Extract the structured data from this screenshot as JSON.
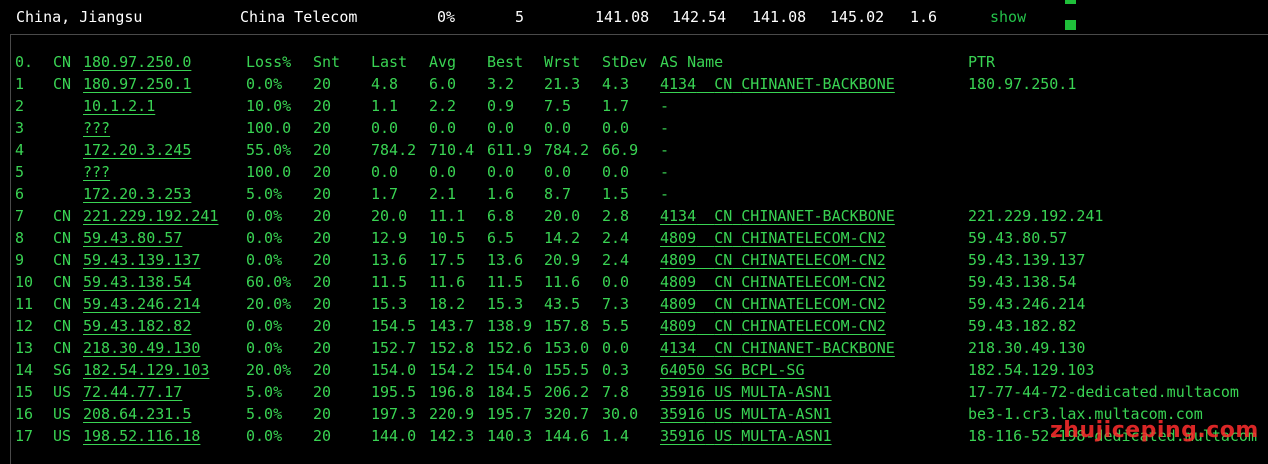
{
  "summary": {
    "location": "China, Jiangsu",
    "isp": "China Telecom",
    "loss": "0%",
    "sent": "5",
    "last": "141.08",
    "avg": "142.54",
    "best": "141.08",
    "worst": "145.02",
    "stdev": "1.6",
    "show_link": "show"
  },
  "headers": {
    "num": "0.",
    "cc": "CN",
    "host": "180.97.250.0",
    "loss": "Loss%",
    "snt": "Snt",
    "last": "Last",
    "avg": "Avg",
    "best": "Best",
    "wrst": "Wrst",
    "stdev": "StDev",
    "asname": "AS Name",
    "ptr": "PTR"
  },
  "rows": [
    {
      "num": "1",
      "cc": "CN",
      "host": "180.97.250.1",
      "loss": "0.0%",
      "snt": "20",
      "last": "4.8",
      "avg": "6.0",
      "best": "3.2",
      "wrst": "21.3",
      "stdev": "4.3",
      "asn": "4134",
      "ascc": "CN",
      "asname": "CHINANET-BACKBONE",
      "ptr": "180.97.250.1"
    },
    {
      "num": "2",
      "cc": "",
      "host": "10.1.2.1",
      "loss": "10.0%",
      "snt": "20",
      "last": "1.1",
      "avg": "2.2",
      "best": "0.9",
      "wrst": "7.5",
      "stdev": "1.7",
      "asn": "-",
      "ascc": "",
      "asname": "",
      "ptr": ""
    },
    {
      "num": "3",
      "cc": "",
      "host": "???",
      "loss": "100.0",
      "snt": "20",
      "last": "0.0",
      "avg": "0.0",
      "best": "0.0",
      "wrst": "0.0",
      "stdev": "0.0",
      "asn": "-",
      "ascc": "",
      "asname": "",
      "ptr": ""
    },
    {
      "num": "4",
      "cc": "",
      "host": "172.20.3.245",
      "loss": "55.0%",
      "snt": "20",
      "last": "784.2",
      "avg": "710.4",
      "best": "611.9",
      "wrst": "784.2",
      "stdev": "66.9",
      "asn": "-",
      "ascc": "",
      "asname": "",
      "ptr": ""
    },
    {
      "num": "5",
      "cc": "",
      "host": "???",
      "loss": "100.0",
      "snt": "20",
      "last": "0.0",
      "avg": "0.0",
      "best": "0.0",
      "wrst": "0.0",
      "stdev": "0.0",
      "asn": "-",
      "ascc": "",
      "asname": "",
      "ptr": ""
    },
    {
      "num": "6",
      "cc": "",
      "host": "172.20.3.253",
      "loss": "5.0%",
      "snt": "20",
      "last": "1.7",
      "avg": "2.1",
      "best": "1.6",
      "wrst": "8.7",
      "stdev": "1.5",
      "asn": "-",
      "ascc": "",
      "asname": "",
      "ptr": ""
    },
    {
      "num": "7",
      "cc": "CN",
      "host": "221.229.192.241",
      "loss": "0.0%",
      "snt": "20",
      "last": "20.0",
      "avg": "11.1",
      "best": "6.8",
      "wrst": "20.0",
      "stdev": "2.8",
      "asn": "4134",
      "ascc": "CN",
      "asname": "CHINANET-BACKBONE",
      "ptr": "221.229.192.241"
    },
    {
      "num": "8",
      "cc": "CN",
      "host": "59.43.80.57",
      "loss": "0.0%",
      "snt": "20",
      "last": "12.9",
      "avg": "10.5",
      "best": "6.5",
      "wrst": "14.2",
      "stdev": "2.4",
      "asn": "4809",
      "ascc": "CN",
      "asname": "CHINATELECOM-CN2",
      "ptr": "59.43.80.57"
    },
    {
      "num": "9",
      "cc": "CN",
      "host": "59.43.139.137",
      "loss": "0.0%",
      "snt": "20",
      "last": "13.6",
      "avg": "17.5",
      "best": "13.6",
      "wrst": "20.9",
      "stdev": "2.4",
      "asn": "4809",
      "ascc": "CN",
      "asname": "CHINATELECOM-CN2",
      "ptr": "59.43.139.137"
    },
    {
      "num": "10",
      "cc": "CN",
      "host": "59.43.138.54",
      "loss": "60.0%",
      "snt": "20",
      "last": "11.5",
      "avg": "11.6",
      "best": "11.5",
      "wrst": "11.6",
      "stdev": "0.0",
      "asn": "4809",
      "ascc": "CN",
      "asname": "CHINATELECOM-CN2",
      "ptr": "59.43.138.54"
    },
    {
      "num": "11",
      "cc": "CN",
      "host": "59.43.246.214",
      "loss": "20.0%",
      "snt": "20",
      "last": "15.3",
      "avg": "18.2",
      "best": "15.3",
      "wrst": "43.5",
      "stdev": "7.3",
      "asn": "4809",
      "ascc": "CN",
      "asname": "CHINATELECOM-CN2",
      "ptr": "59.43.246.214"
    },
    {
      "num": "12",
      "cc": "CN",
      "host": "59.43.182.82",
      "loss": "0.0%",
      "snt": "20",
      "last": "154.5",
      "avg": "143.7",
      "best": "138.9",
      "wrst": "157.8",
      "stdev": "5.5",
      "asn": "4809",
      "ascc": "CN",
      "asname": "CHINATELECOM-CN2",
      "ptr": "59.43.182.82"
    },
    {
      "num": "13",
      "cc": "CN",
      "host": "218.30.49.130",
      "loss": "0.0%",
      "snt": "20",
      "last": "152.7",
      "avg": "152.8",
      "best": "152.6",
      "wrst": "153.0",
      "stdev": "0.0",
      "asn": "4134",
      "ascc": "CN",
      "asname": "CHINANET-BACKBONE",
      "ptr": "218.30.49.130"
    },
    {
      "num": "14",
      "cc": "SG",
      "host": "182.54.129.103",
      "loss": "20.0%",
      "snt": "20",
      "last": "154.0",
      "avg": "154.2",
      "best": "154.0",
      "wrst": "155.5",
      "stdev": "0.3",
      "asn": "64050",
      "ascc": "SG",
      "asname": "BCPL-SG",
      "ptr": "182.54.129.103"
    },
    {
      "num": "15",
      "cc": "US",
      "host": "72.44.77.17",
      "loss": "5.0%",
      "snt": "20",
      "last": "195.5",
      "avg": "196.8",
      "best": "184.5",
      "wrst": "206.2",
      "stdev": "7.8",
      "asn": "35916",
      "ascc": "US",
      "asname": "MULTA-ASN1",
      "ptr": "17-77-44-72-dedicated.multacom"
    },
    {
      "num": "16",
      "cc": "US",
      "host": "208.64.231.5",
      "loss": "5.0%",
      "snt": "20",
      "last": "197.3",
      "avg": "220.9",
      "best": "195.7",
      "wrst": "320.7",
      "stdev": "30.0",
      "asn": "35916",
      "ascc": "US",
      "asname": "MULTA-ASN1",
      "ptr": "be3-1.cr3.lax.multacom.com"
    },
    {
      "num": "17",
      "cc": "US",
      "host": "198.52.116.18",
      "loss": "0.0%",
      "snt": "20",
      "last": "144.0",
      "avg": "142.3",
      "best": "140.3",
      "wrst": "144.6",
      "stdev": "1.4",
      "asn": "35916",
      "ascc": "US",
      "asname": "MULTA-ASN1",
      "ptr": "18-116-52-198-dedicated.multacom"
    }
  ],
  "watermark": "zhujiceping.com",
  "colors": {
    "text_green": "#39d353",
    "background": "#000000",
    "summary_text": "#ffffff",
    "watermark": "#ff2d2d"
  }
}
